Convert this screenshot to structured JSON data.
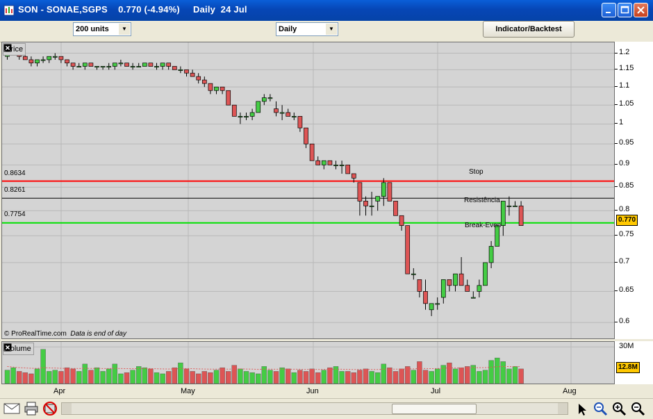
{
  "window": {
    "title": "SON - SONAE,SGPS    0.770 (-4.94%)     Daily  24 Jul"
  },
  "toolbar": {
    "units_value": "200 units",
    "period_value": "Daily",
    "indicator_button": "Indicator/Backtest"
  },
  "price_pane": {
    "title": "Price",
    "credit": "© ProRealTime.com",
    "credit_note": "Data is end of day",
    "levels": [
      {
        "label": "0.8634",
        "value": 0.8634,
        "color": "#ff0000",
        "annotation": "Stop"
      },
      {
        "label": "0.8261",
        "value": 0.8261,
        "color": "#000000",
        "annotation": "Resistência"
      },
      {
        "label": "0.7754",
        "value": 0.7754,
        "color": "#00e000",
        "annotation": "Break-Even"
      }
    ],
    "current_price_badge": "0.770"
  },
  "volume_pane": {
    "title": "Volume",
    "axis_label": "30M",
    "current_badge": "12.8M"
  },
  "colors": {
    "up": "#44cc44",
    "down": "#dd5555",
    "pane_bg": "#d4d4d4",
    "grid": "#b8b8b8"
  },
  "icons": [
    "wrench-icon",
    "window-icon",
    "close-icon",
    "print-icon",
    "no-print-icon",
    "cursor-icon",
    "zoom-in-icon",
    "zoom-out-icon",
    "zoom-reset-icon"
  ],
  "chart_data": [
    {
      "type": "candlestick",
      "title": "",
      "x_labels": [
        "Apr",
        "May",
        "Jun",
        "Jul",
        "Aug"
      ],
      "y_ticks": [
        "1.2",
        "1.15",
        "1.1",
        "1.05",
        "1",
        "0.95",
        "0.9",
        "0.85",
        "0.8",
        "0.75",
        "0.7",
        "0.65",
        "0.6"
      ],
      "ylim": [
        0.578,
        1.225
      ],
      "y_scale": "log",
      "ohlc": [
        [
          1.19,
          1.2,
          1.18,
          1.2
        ],
        [
          1.2,
          1.21,
          1.2,
          1.2
        ],
        [
          1.2,
          1.2,
          1.18,
          1.19
        ],
        [
          1.19,
          1.2,
          1.18,
          1.18
        ],
        [
          1.18,
          1.19,
          1.16,
          1.17
        ],
        [
          1.17,
          1.18,
          1.16,
          1.18
        ],
        [
          1.18,
          1.19,
          1.17,
          1.18
        ],
        [
          1.18,
          1.19,
          1.17,
          1.19
        ],
        [
          1.19,
          1.2,
          1.18,
          1.19
        ],
        [
          1.19,
          1.19,
          1.17,
          1.18
        ],
        [
          1.18,
          1.18,
          1.16,
          1.17
        ],
        [
          1.17,
          1.17,
          1.15,
          1.16
        ],
        [
          1.16,
          1.17,
          1.16,
          1.16
        ],
        [
          1.16,
          1.17,
          1.15,
          1.17
        ],
        [
          1.17,
          1.17,
          1.16,
          1.16
        ],
        [
          1.16,
          1.16,
          1.15,
          1.16
        ],
        [
          1.16,
          1.16,
          1.15,
          1.16
        ],
        [
          1.16,
          1.17,
          1.15,
          1.16
        ],
        [
          1.16,
          1.17,
          1.15,
          1.17
        ],
        [
          1.17,
          1.18,
          1.16,
          1.17
        ],
        [
          1.17,
          1.17,
          1.16,
          1.16
        ],
        [
          1.16,
          1.17,
          1.15,
          1.16
        ],
        [
          1.16,
          1.17,
          1.16,
          1.16
        ],
        [
          1.16,
          1.17,
          1.16,
          1.17
        ],
        [
          1.17,
          1.17,
          1.16,
          1.16
        ],
        [
          1.16,
          1.17,
          1.15,
          1.16
        ],
        [
          1.16,
          1.17,
          1.15,
          1.17
        ],
        [
          1.17,
          1.17,
          1.15,
          1.16
        ],
        [
          1.16,
          1.16,
          1.15,
          1.15
        ],
        [
          1.15,
          1.16,
          1.14,
          1.15
        ],
        [
          1.15,
          1.15,
          1.13,
          1.14
        ],
        [
          1.14,
          1.15,
          1.13,
          1.13
        ],
        [
          1.13,
          1.14,
          1.11,
          1.12
        ],
        [
          1.12,
          1.13,
          1.1,
          1.11
        ],
        [
          1.11,
          1.11,
          1.08,
          1.09
        ],
        [
          1.09,
          1.1,
          1.08,
          1.1
        ],
        [
          1.1,
          1.1,
          1.08,
          1.09
        ],
        [
          1.09,
          1.09,
          1.05,
          1.05
        ],
        [
          1.05,
          1.05,
          1.02,
          1.02
        ],
        [
          1.02,
          1.03,
          1.0,
          1.02
        ],
        [
          1.02,
          1.03,
          1.01,
          1.02
        ],
        [
          1.02,
          1.04,
          1.01,
          1.03
        ],
        [
          1.03,
          1.06,
          1.03,
          1.06
        ],
        [
          1.06,
          1.08,
          1.05,
          1.07
        ],
        [
          1.07,
          1.08,
          1.06,
          1.07
        ],
        [
          1.04,
          1.06,
          1.02,
          1.03
        ],
        [
          1.03,
          1.05,
          1.01,
          1.03
        ],
        [
          1.03,
          1.04,
          1.02,
          1.02
        ],
        [
          1.02,
          1.03,
          1.01,
          1.02
        ],
        [
          1.02,
          1.02,
          0.98,
          0.99
        ],
        [
          0.99,
          0.99,
          0.94,
          0.95
        ],
        [
          0.95,
          0.95,
          0.91,
          0.91
        ],
        [
          0.91,
          0.92,
          0.9,
          0.9
        ],
        [
          0.9,
          0.91,
          0.89,
          0.91
        ],
        [
          0.91,
          0.91,
          0.9,
          0.9
        ],
        [
          0.9,
          0.91,
          0.89,
          0.9
        ],
        [
          0.9,
          0.91,
          0.88,
          0.9
        ],
        [
          0.9,
          0.9,
          0.88,
          0.88
        ],
        [
          0.88,
          0.88,
          0.86,
          0.87
        ],
        [
          0.86,
          0.86,
          0.79,
          0.82
        ],
        [
          0.82,
          0.83,
          0.79,
          0.81
        ],
        [
          0.81,
          0.84,
          0.79,
          0.81
        ],
        [
          0.82,
          0.83,
          0.8,
          0.83
        ],
        [
          0.83,
          0.87,
          0.81,
          0.86
        ],
        [
          0.86,
          0.86,
          0.82,
          0.82
        ],
        [
          0.82,
          0.82,
          0.79,
          0.79
        ],
        [
          0.79,
          0.79,
          0.76,
          0.77
        ],
        [
          0.77,
          0.77,
          0.68,
          0.68
        ],
        [
          0.68,
          0.69,
          0.67,
          0.68
        ],
        [
          0.67,
          0.67,
          0.64,
          0.65
        ],
        [
          0.65,
          0.67,
          0.62,
          0.63
        ],
        [
          0.62,
          0.63,
          0.61,
          0.63
        ],
        [
          0.63,
          0.64,
          0.62,
          0.63
        ],
        [
          0.64,
          0.67,
          0.63,
          0.67
        ],
        [
          0.67,
          0.67,
          0.65,
          0.66
        ],
        [
          0.66,
          0.68,
          0.65,
          0.68
        ],
        [
          0.68,
          0.71,
          0.66,
          0.66
        ],
        [
          0.66,
          0.67,
          0.65,
          0.65
        ],
        [
          0.64,
          0.65,
          0.64,
          0.64
        ],
        [
          0.65,
          0.67,
          0.64,
          0.66
        ],
        [
          0.66,
          0.7,
          0.66,
          0.7
        ],
        [
          0.7,
          0.74,
          0.69,
          0.73
        ],
        [
          0.73,
          0.77,
          0.73,
          0.77
        ],
        [
          0.77,
          0.82,
          0.75,
          0.82
        ],
        [
          0.81,
          0.83,
          0.79,
          0.81
        ],
        [
          0.81,
          0.82,
          0.81,
          0.81
        ],
        [
          0.81,
          0.82,
          0.77,
          0.77
        ]
      ]
    },
    {
      "type": "bar",
      "title": "",
      "ylabel": "Volume",
      "y_ticks": [
        "30M"
      ],
      "ylim": [
        0,
        33
      ],
      "values_millions": [
        11,
        13,
        10,
        9,
        8,
        12,
        28,
        10,
        11,
        10,
        13,
        12,
        10,
        16,
        11,
        13,
        10,
        12,
        16,
        8,
        9,
        11,
        14,
        13,
        12,
        9,
        8,
        10,
        13,
        17,
        12,
        10,
        8,
        10,
        9,
        11,
        13,
        10,
        15,
        12,
        10,
        9,
        8,
        14,
        11,
        10,
        13,
        12,
        9,
        11,
        10,
        12,
        9,
        11,
        13,
        14,
        10,
        10,
        9,
        11,
        12,
        10,
        9,
        16,
        13,
        10,
        12,
        14,
        11,
        18,
        11,
        10,
        12,
        15,
        17,
        12,
        13,
        14,
        15,
        10,
        11,
        19,
        21,
        18,
        12,
        14,
        12
      ],
      "ma": [
        14,
        13.5,
        13,
        12.8,
        12.5,
        12.4,
        13,
        12.8,
        12.7,
        12.5,
        12.4,
        12.4,
        12.3,
        12.5,
        12.4,
        12.4,
        12.3,
        12.3,
        12.5,
        12.3,
        12.2,
        12.2,
        12.3,
        12.3,
        12.3,
        12.1,
        12,
        11.9,
        12,
        12.3,
        12.3,
        12.2,
        12,
        11.9,
        11.8,
        11.8,
        11.9,
        11.8,
        12,
        12,
        11.9,
        11.8,
        11.6,
        11.8,
        11.8,
        11.7,
        11.8,
        11.8,
        11.7,
        11.7,
        11.6,
        11.7,
        11.6,
        11.6,
        11.7,
        11.8,
        11.7,
        11.6,
        11.5,
        11.5,
        11.6,
        11.5,
        11.5,
        11.8,
        11.9,
        11.8,
        11.9,
        12,
        12,
        12.4,
        12.3,
        12.2,
        12.3,
        12.5,
        12.8,
        12.8,
        12.8,
        13,
        13.1,
        13,
        13,
        13.4,
        13.8,
        14,
        13.9,
        13.9,
        13.9
      ]
    }
  ]
}
